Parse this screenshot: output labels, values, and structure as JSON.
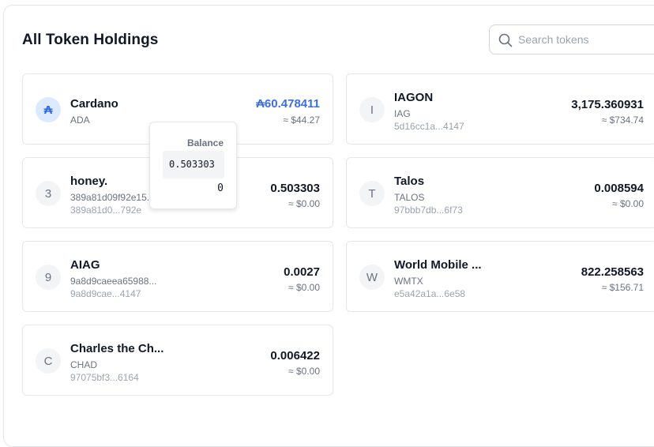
{
  "header": {
    "title": "All Token Holdings",
    "search_placeholder": "Search tokens"
  },
  "tokens": [
    {
      "avatar": "₳",
      "name": "Cardano",
      "ticker": "ADA",
      "policy": "",
      "amount": "₳60.478411",
      "fiat": "≈ $44.27"
    },
    {
      "avatar": "I",
      "name": "IAGON",
      "ticker": "IAG",
      "policy": "5d16cc1a...4147",
      "amount": "3,175.360931",
      "fiat": "≈ $734.74"
    },
    {
      "avatar": "3",
      "name": "honey.",
      "ticker": "389a81d09f92e15...",
      "policy": "389a81d0...792e",
      "amount": "0.503303",
      "fiat": "≈ $0.00"
    },
    {
      "avatar": "T",
      "name": "Talos",
      "ticker": "TALOS",
      "policy": "97bbb7db...6f73",
      "amount": "0.008594",
      "fiat": "≈ $0.00"
    },
    {
      "avatar": "9",
      "name": "AIAG",
      "ticker": "9a8d9caeea65988...",
      "policy": "9a8d9cae...4147",
      "amount": "0.0027",
      "fiat": "≈ $0.00"
    },
    {
      "avatar": "W",
      "name": "World Mobile ...",
      "ticker": "WMTX",
      "policy": "e5a42a1a...6e58",
      "amount": "822.258563",
      "fiat": "≈ $156.71"
    },
    {
      "avatar": "C",
      "name": "Charles the Ch...",
      "ticker": "CHAD",
      "policy": "97075bf3...6164",
      "amount": "0.006422",
      "fiat": "≈ $0.00"
    }
  ],
  "tooltip": {
    "title": "Balance",
    "value": "0.503303",
    "decimals": "0"
  },
  "colors": {
    "accent": "#3b6fe0",
    "ada_avatar_bg": "#dbeafe",
    "border": "#e5e7eb"
  }
}
